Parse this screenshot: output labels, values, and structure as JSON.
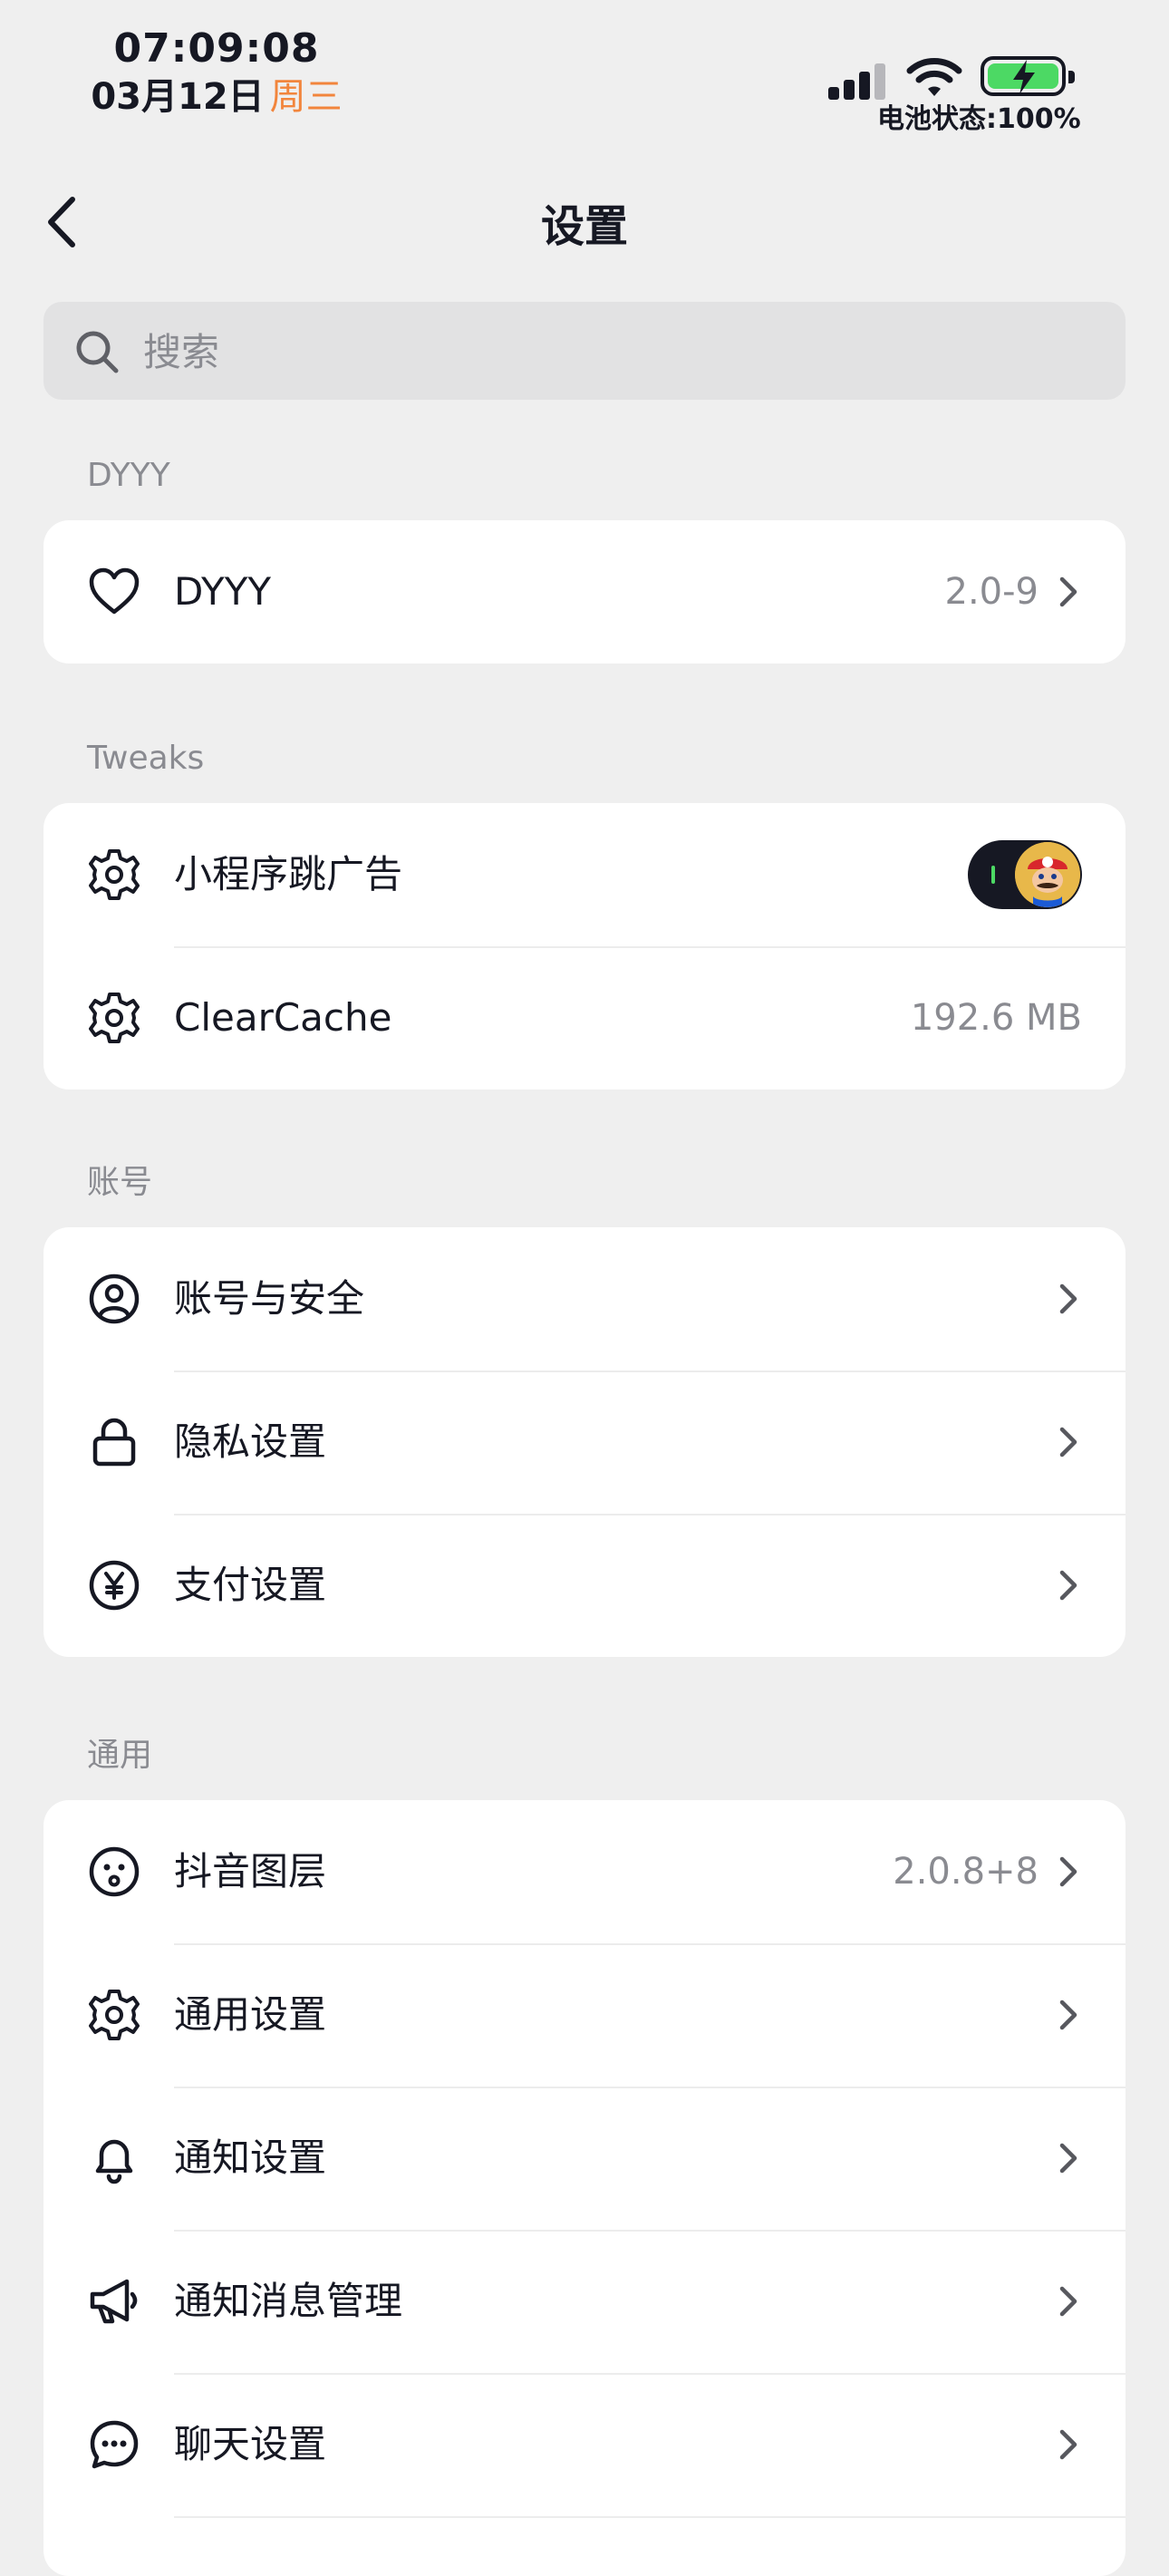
{
  "status": {
    "time": "07:09:08",
    "date": "03月12日",
    "weekday": "周三",
    "battery_text": "电池状态:100%",
    "battery_level": 1.0
  },
  "nav": {
    "title": "设置"
  },
  "search": {
    "placeholder": "搜索"
  },
  "sections": {
    "dyyy": {
      "title": "DYYY",
      "items": [
        {
          "icon": "heart-icon",
          "label": "DYYY",
          "value": "2.0-9"
        }
      ]
    },
    "tweaks": {
      "title": "Tweaks",
      "items": [
        {
          "icon": "gear-icon",
          "label": "小程序跳广告",
          "toggle_on": true
        },
        {
          "icon": "gear-icon",
          "label": "ClearCache",
          "value": "192.6 MB"
        }
      ]
    },
    "account": {
      "title": "账号",
      "items": [
        {
          "icon": "user-circle-icon",
          "label": "账号与安全"
        },
        {
          "icon": "lock-icon",
          "label": "隐私设置"
        },
        {
          "icon": "yen-icon",
          "label": "支付设置"
        }
      ]
    },
    "general": {
      "title": "通用",
      "items": [
        {
          "icon": "face-icon",
          "label": "抖音图层",
          "value": "2.0.8+8"
        },
        {
          "icon": "gear-icon",
          "label": "通用设置"
        },
        {
          "icon": "bell-icon",
          "label": "通知设置"
        },
        {
          "icon": "megaphone-icon",
          "label": "通知消息管理"
        },
        {
          "icon": "chat-bubble-icon",
          "label": "聊天设置"
        }
      ]
    }
  },
  "colors": {
    "background": "#efefef",
    "card": "#ffffff",
    "text": "#161823",
    "secondary_text": "#8a8b91",
    "weekday_accent": "#f2853c",
    "battery_green": "#4cd964"
  }
}
